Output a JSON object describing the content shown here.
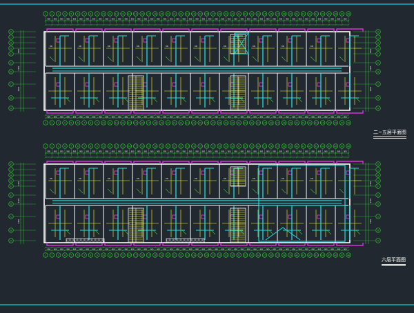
{
  "drawing": {
    "background": "#212830",
    "colors": {
      "wall": "#ffffff",
      "partition": "#ffff33",
      "axis": "#33cc33",
      "pipe": "#22dddd",
      "fixture": "#ff33ff",
      "stair": "#ffffff",
      "frame": "#00ffff"
    },
    "plans": [
      {
        "name": "plan-upper",
        "axis_numbers_top": [
          "1",
          "2",
          "3",
          "4",
          "5",
          "6",
          "7",
          "8",
          "9",
          "10",
          "11",
          "12",
          "13",
          "14",
          "15",
          "16",
          "17",
          "18",
          "19",
          "20",
          "21",
          "22",
          "23",
          "24",
          "25",
          "26",
          "27",
          "28",
          "29",
          "30",
          "31",
          "32",
          "33",
          "34",
          "35",
          "36",
          "37",
          "38",
          "39",
          "40",
          "41",
          "42",
          "43",
          "44",
          "45",
          "46",
          "47",
          "48"
        ],
        "axis_letters_left": [
          "K",
          "J",
          "H",
          "G",
          "F",
          "E",
          "D",
          "C",
          "B",
          "A"
        ],
        "axis_letters_right": [
          "K",
          "J",
          "H",
          "G",
          "F",
          "E",
          "D",
          "C",
          "B",
          "A"
        ],
        "caption": "二~五层平面图",
        "caption_sub": "1:100"
      },
      {
        "name": "plan-lower",
        "axis_numbers_top": [
          "1",
          "2",
          "3",
          "4",
          "5",
          "6",
          "7",
          "8",
          "9",
          "10",
          "11",
          "12",
          "13",
          "14",
          "15",
          "16",
          "17",
          "18",
          "19",
          "20",
          "21",
          "22",
          "23",
          "24",
          "25",
          "26",
          "27",
          "28",
          "29",
          "30",
          "31",
          "32",
          "33",
          "34",
          "35",
          "36",
          "37",
          "38",
          "39",
          "40",
          "41",
          "42",
          "43",
          "44",
          "45",
          "46",
          "47",
          "48"
        ],
        "axis_letters_left": [
          "K",
          "J",
          "H",
          "G",
          "F",
          "E",
          "D",
          "C",
          "B",
          "A"
        ],
        "axis_letters_right": [
          "K",
          "J",
          "H",
          "G",
          "F",
          "E",
          "D",
          "C",
          "B",
          "A"
        ],
        "caption": "六层平面图",
        "caption_sub": "1:100"
      }
    ]
  }
}
